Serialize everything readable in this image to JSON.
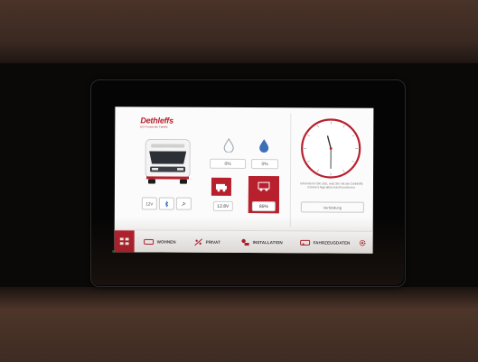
{
  "brand": {
    "name": "Dethleffs",
    "tagline": "Ein Freund der Familie"
  },
  "left_panel": {
    "voltage_chip": "12V"
  },
  "tanks": {
    "fresh_water": "0%",
    "waste_water": "0%"
  },
  "batteries": {
    "vehicle_battery": "12.8V",
    "living_battery": "85%",
    "living_battery_level_percent": 85
  },
  "clock": {
    "time_shown": "11:30"
  },
  "connect": {
    "info_text": "Informieren Sie sich, was Sie mit der Dethleffs Connect App alles machen können.",
    "button_label": "Verbindung"
  },
  "navigation": {
    "items": [
      {
        "label": "WOHNEN",
        "icon": "living-icon"
      },
      {
        "label": "PRIVAT",
        "icon": "privat-icon"
      },
      {
        "label": "INSTALLATION",
        "icon": "installation-icon"
      },
      {
        "label": "FAHRZEUGDATEN",
        "icon": "vehicle-data-icon"
      }
    ]
  },
  "colors": {
    "accent": "#b8202d",
    "background": "#fbfbfb"
  }
}
